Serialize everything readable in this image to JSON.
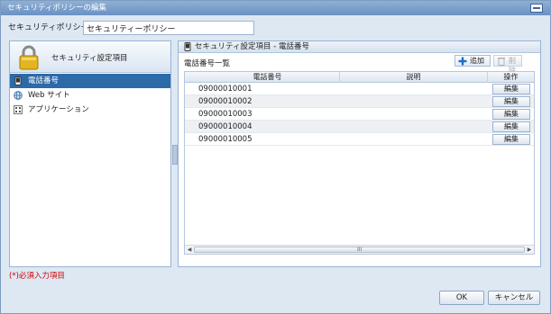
{
  "window": {
    "title": "セキュリティポリシーの編集",
    "restore_icon": "restore-window-icon"
  },
  "policy": {
    "label": "セキュリティポリシー名:",
    "required_mark": "*",
    "name_value": "セキュリティーポリシー"
  },
  "left_panel": {
    "header_label": "セキュリティ設定項目",
    "header_icon": "lock-icon",
    "items": [
      {
        "label": "電話番号",
        "icon": "phone-icon",
        "selected": true
      },
      {
        "label": "Web サイト",
        "icon": "globe-icon",
        "selected": false
      },
      {
        "label": "アプリケーション",
        "icon": "app-grid-icon",
        "selected": false
      }
    ]
  },
  "right_panel": {
    "header_label": "セキュリティ設定項目 - 電話番号",
    "list_title": "電話番号一覧",
    "add_label": "追加",
    "delete_label": "削除",
    "columns": {
      "phone": "電話番号",
      "description": "説明",
      "operation": "操作"
    },
    "rows": [
      {
        "phone": "09000010001",
        "description": "",
        "edit": "編集"
      },
      {
        "phone": "09000010002",
        "description": "",
        "edit": "編集"
      },
      {
        "phone": "09000010003",
        "description": "",
        "edit": "編集"
      },
      {
        "phone": "09000010004",
        "description": "",
        "edit": "編集"
      },
      {
        "phone": "09000010005",
        "description": "",
        "edit": "編集"
      }
    ],
    "scroll_grip": "III"
  },
  "required_note": "(*)必須入力項目",
  "buttons": {
    "ok": "OK",
    "cancel": "キャンセル"
  },
  "colors": {
    "selection": "#2c6aa8",
    "required": "#d00000",
    "frame_bg": "#dde8f3"
  }
}
